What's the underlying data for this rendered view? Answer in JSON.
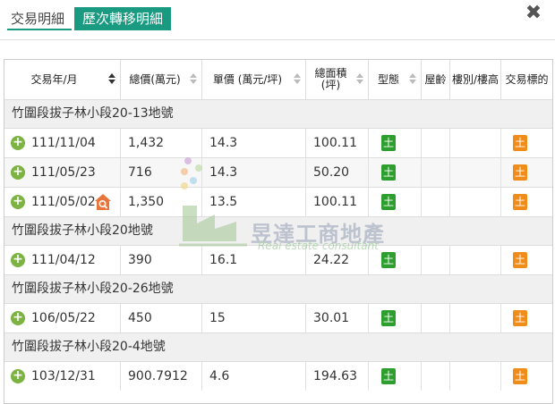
{
  "tabs": [
    {
      "label": "交易明細",
      "active": false
    },
    {
      "label": "歷次轉移明細",
      "active": true
    }
  ],
  "close_label": "✖",
  "table": {
    "headers": [
      "交易年/月",
      "總價(萬元)",
      "單價 (萬元/坪)",
      "總面積\n(坪)",
      "型態",
      "屋齡",
      "樓別/樓高",
      "交易標的"
    ],
    "groups": [
      {
        "title": "竹圍段拔子林小段20-13地號",
        "rows": [
          {
            "date": "111/11/04",
            "total": "1,432",
            "unit": "14.3",
            "area": "100.11",
            "type": "土",
            "target": "土",
            "has_house_icon": false
          },
          {
            "date": "111/05/23",
            "total": "716",
            "unit": "14.3",
            "area": "50.20",
            "type": "土",
            "target": "土",
            "has_house_icon": false
          },
          {
            "date": "111/05/02",
            "total": "1,350",
            "unit": "13.5",
            "area": "100.11",
            "type": "土",
            "target": "土",
            "has_house_icon": true
          }
        ]
      },
      {
        "title": "竹圍段拔子林小段20地號",
        "rows": [
          {
            "date": "111/04/12",
            "total": "390",
            "unit": "16.1",
            "area": "24.22",
            "type": "土",
            "target": "土",
            "has_house_icon": false
          }
        ]
      },
      {
        "title": "竹圍段拔子林小段20-26地號",
        "rows": [
          {
            "date": "106/05/22",
            "total": "450",
            "unit": "15",
            "area": "30.01",
            "type": "土",
            "target": "土",
            "has_house_icon": false
          }
        ]
      },
      {
        "title": "竹圍段拔子林小段20-4地號",
        "rows": [
          {
            "date": "103/12/31",
            "total": "900.7912",
            "unit": "4.6",
            "area": "194.63",
            "type": "土",
            "target": "土",
            "has_house_icon": false
          }
        ]
      }
    ]
  },
  "watermark": {
    "name": "昱達工商地產",
    "tagline": "Real estate consultant"
  },
  "colors": {
    "accent": "#1a9a80",
    "plus": "#7cb342",
    "type_badge": "#2e9e2e",
    "target_badge": "#f08c1a",
    "house_icon": "#e8743b"
  }
}
